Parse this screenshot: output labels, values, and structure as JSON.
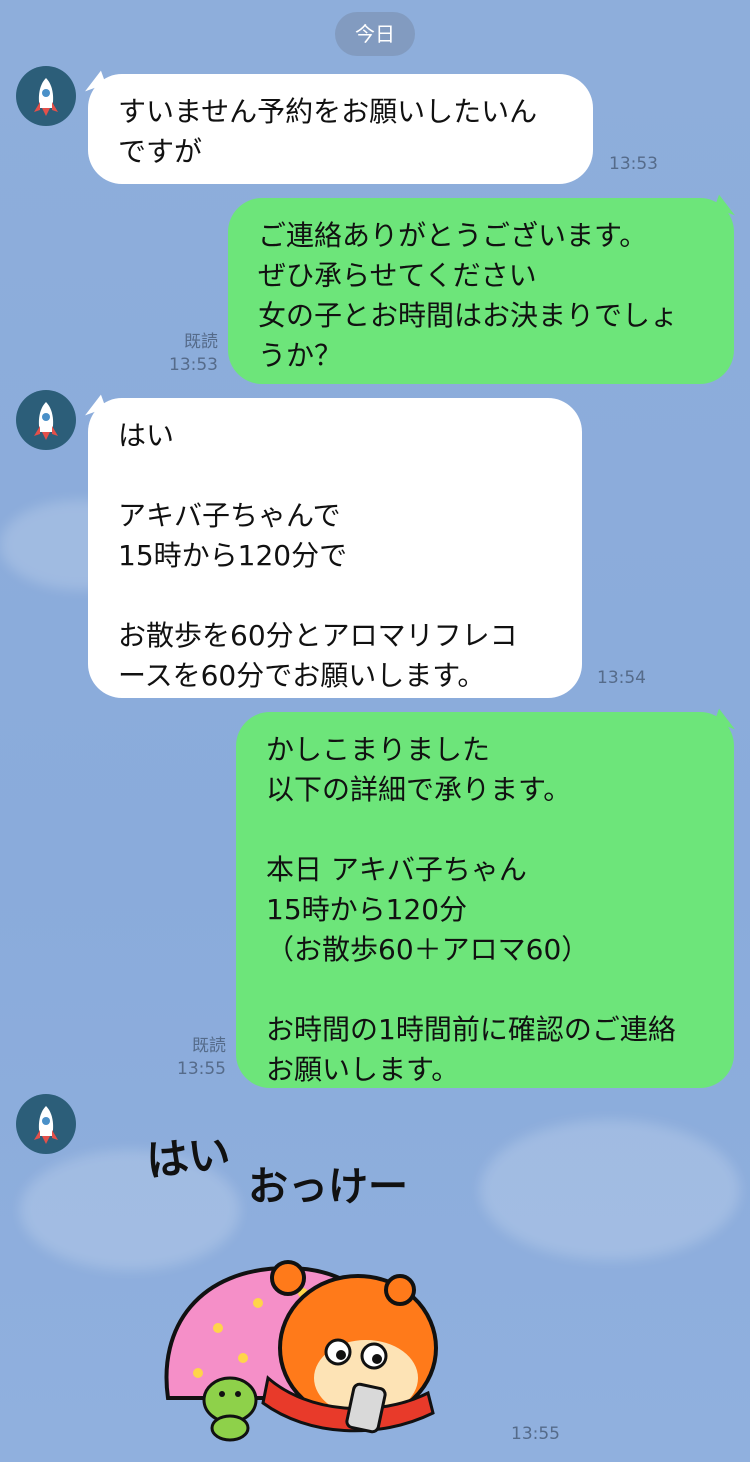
{
  "date_divider": "今日",
  "messages": [
    {
      "side": "in",
      "text": "すいません予約をお願いしたいん\nですが",
      "time": "13:53"
    },
    {
      "side": "out",
      "text": "ご連絡ありがとうございます。\nぜひ承らせてください\n女の子とお時間はお決まりでしょ\nうか？",
      "read": "既読",
      "time": "13:53"
    },
    {
      "side": "in",
      "text": "はい\n\nアキバ子ちゃんで\n15時から120分で\n\nお散歩を60分とアロマリフレコ\nースを60分でお願いします。",
      "time": "13:54"
    },
    {
      "side": "out",
      "text": "かしこまりました\n以下の詳細で承ります。\n\n本日 アキバ子ちゃん\n15時から120分\n（お散歩60＋アロマ60）\n\nお時間の1時間前に確認のご連絡\nお願いします。",
      "read": "既読",
      "time": "13:55"
    },
    {
      "side": "in",
      "type": "sticker",
      "sticker_text": "はい おっけー",
      "time": "13:55"
    }
  ],
  "colors": {
    "background": "#8aabdb",
    "incoming_bubble": "#ffffff",
    "outgoing_bubble": "#6de57a",
    "avatar_bg": "#2c5e79"
  },
  "icons": {
    "avatar": "rocket-icon"
  }
}
